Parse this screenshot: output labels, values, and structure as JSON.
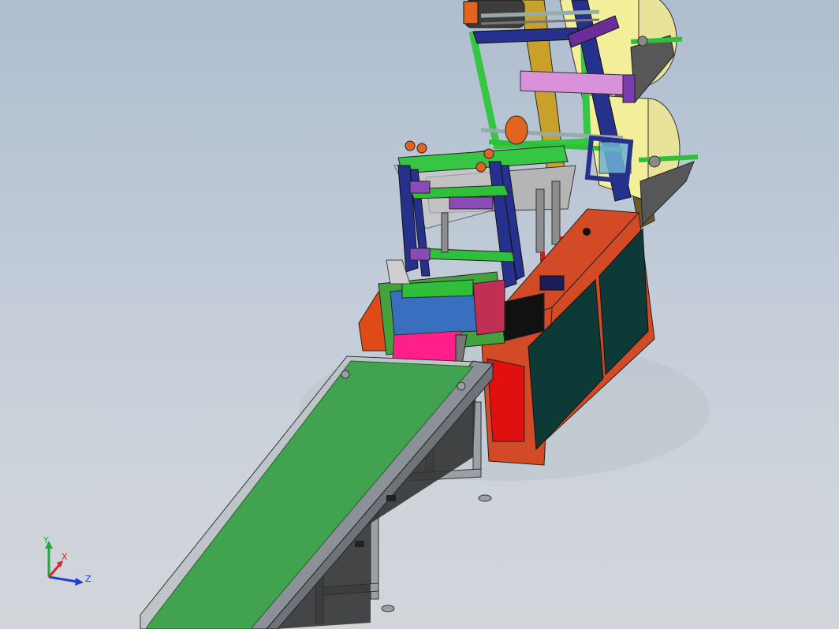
{
  "viewport": {
    "background_top": "#aebdcf",
    "background_bottom": "#d2d6db"
  },
  "triad": {
    "y_label": "Y",
    "x_label": "X",
    "z_label": "Z",
    "y_color": "#1faa3a",
    "x_color": "#d02a2a",
    "z_color": "#2040d0"
  },
  "colors": {
    "conveyor_belt": "#41a24f",
    "conveyor_frame": "#9aa0a6",
    "cabinet": "#d24a26",
    "cabinet_panel": "#0d3a36",
    "cabinet_red": "#e01010",
    "roll": "#f2ee9a",
    "frame_green": "#37c544",
    "frame_blue": "#25318c",
    "magenta": "#ff1f8a",
    "purple": "#7a3bb0"
  }
}
